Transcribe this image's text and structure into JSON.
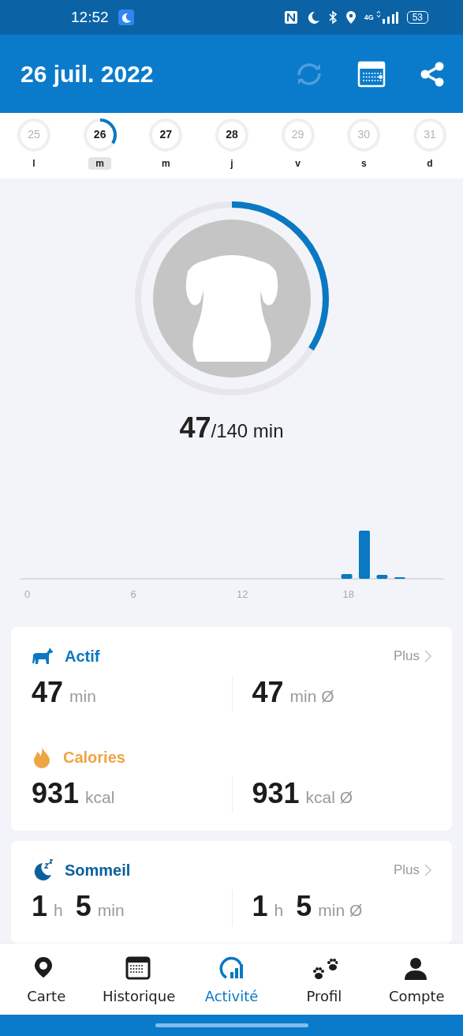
{
  "status_bar": {
    "time": "12:52",
    "network": "4G",
    "battery": "53"
  },
  "header": {
    "title": "26 juil. 2022"
  },
  "days": [
    {
      "number": "25",
      "weekday": "l",
      "selected": false,
      "disabled": true
    },
    {
      "number": "26",
      "weekday": "m",
      "selected": true,
      "disabled": false
    },
    {
      "number": "27",
      "weekday": "m",
      "selected": false,
      "disabled": false
    },
    {
      "number": "28",
      "weekday": "j",
      "selected": false,
      "disabled": false
    },
    {
      "number": "29",
      "weekday": "v",
      "selected": false,
      "disabled": true
    },
    {
      "number": "30",
      "weekday": "s",
      "selected": false,
      "disabled": true
    },
    {
      "number": "31",
      "weekday": "d",
      "selected": false,
      "disabled": true
    }
  ],
  "goal": {
    "value": "47",
    "target": "/140 min"
  },
  "activity_chart": {
    "axis_labels": [
      "0",
      "6",
      "12",
      "18"
    ]
  },
  "cards": [
    {
      "sections": [
        {
          "kind": "active",
          "title": "Actif",
          "color": "#0a78c2",
          "more": "Plus",
          "stats": [
            [
              {
                "value": "47",
                "unit": "min"
              }
            ],
            [
              {
                "value": "47",
                "unit": "min Ø"
              }
            ]
          ]
        },
        {
          "kind": "calories",
          "title": "Calories",
          "color": "#eea543",
          "stats": [
            [
              {
                "value": "931",
                "unit": "kcal"
              }
            ],
            [
              {
                "value": "931",
                "unit": "kcal Ø"
              }
            ]
          ]
        }
      ]
    },
    {
      "sections": [
        {
          "kind": "sleep",
          "title": "Sommeil",
          "color": "#0b5f9c",
          "more": "Plus",
          "stats": [
            [
              {
                "value": "1",
                "unit": "h"
              },
              {
                "value": "5",
                "unit": "min"
              }
            ],
            [
              {
                "value": "1",
                "unit": "h"
              },
              {
                "value": "5",
                "unit": "min Ø"
              }
            ]
          ]
        }
      ]
    }
  ],
  "nav": [
    {
      "kind": "map",
      "label": "Carte",
      "selected": false
    },
    {
      "kind": "history",
      "label": "Historique",
      "selected": false
    },
    {
      "kind": "activity",
      "label": "Activité",
      "selected": true
    },
    {
      "kind": "profile",
      "label": "Profil",
      "selected": false
    },
    {
      "kind": "account",
      "label": "Compte",
      "selected": false
    }
  ]
}
